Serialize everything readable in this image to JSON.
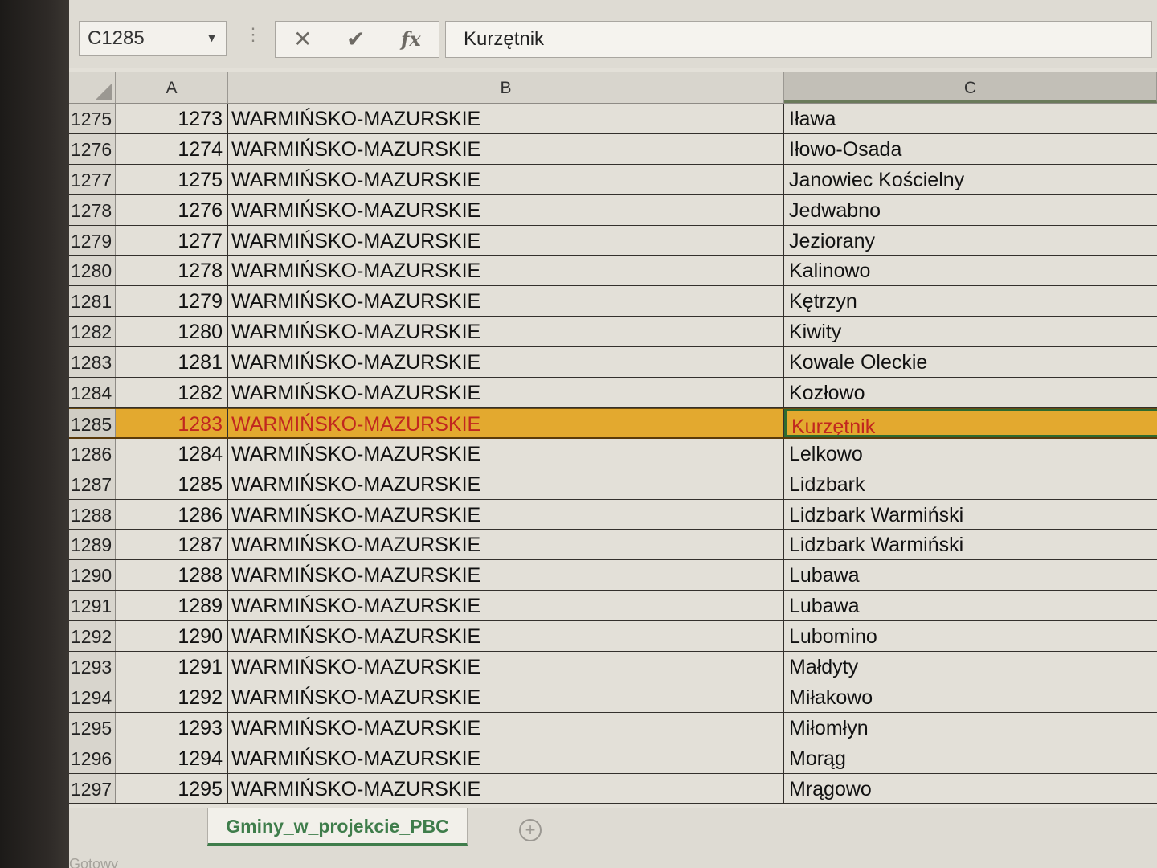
{
  "formula_bar": {
    "name_box": "C1285",
    "name_box_dropdown_icon": "chevron-down-icon",
    "options_icon": "vertical-dots-icon",
    "cancel_icon": "close-icon",
    "enter_icon": "checkmark-icon",
    "function_label": "fx",
    "content": "Kurzętnik"
  },
  "columns": [
    {
      "key": "A",
      "label": "A"
    },
    {
      "key": "B",
      "label": "B"
    },
    {
      "key": "C",
      "label": "C"
    }
  ],
  "rows": [
    {
      "row": "1275",
      "a": "1273",
      "b": "WARMIŃSKO-MAZURSKIE",
      "c": "Iława"
    },
    {
      "row": "1276",
      "a": "1274",
      "b": "WARMIŃSKO-MAZURSKIE",
      "c": "Iłowo-Osada"
    },
    {
      "row": "1277",
      "a": "1275",
      "b": "WARMIŃSKO-MAZURSKIE",
      "c": "Janowiec Kościelny"
    },
    {
      "row": "1278",
      "a": "1276",
      "b": "WARMIŃSKO-MAZURSKIE",
      "c": "Jedwabno"
    },
    {
      "row": "1279",
      "a": "1277",
      "b": "WARMIŃSKO-MAZURSKIE",
      "c": "Jeziorany"
    },
    {
      "row": "1280",
      "a": "1278",
      "b": "WARMIŃSKO-MAZURSKIE",
      "c": "Kalinowo"
    },
    {
      "row": "1281",
      "a": "1279",
      "b": "WARMIŃSKO-MAZURSKIE",
      "c": "Kętrzyn"
    },
    {
      "row": "1282",
      "a": "1280",
      "b": "WARMIŃSKO-MAZURSKIE",
      "c": "Kiwity"
    },
    {
      "row": "1283",
      "a": "1281",
      "b": "WARMIŃSKO-MAZURSKIE",
      "c": "Kowale Oleckie"
    },
    {
      "row": "1284",
      "a": "1282",
      "b": "WARMIŃSKO-MAZURSKIE",
      "c": "Kozłowo"
    },
    {
      "row": "1285",
      "a": "1283",
      "b": "WARMIŃSKO-MAZURSKIE",
      "c": "Kurzętnik",
      "highlighted": true
    },
    {
      "row": "1286",
      "a": "1284",
      "b": "WARMIŃSKO-MAZURSKIE",
      "c": "Lelkowo"
    },
    {
      "row": "1287",
      "a": "1285",
      "b": "WARMIŃSKO-MAZURSKIE",
      "c": "Lidzbark"
    },
    {
      "row": "1288",
      "a": "1286",
      "b": "WARMIŃSKO-MAZURSKIE",
      "c": "Lidzbark Warmiński"
    },
    {
      "row": "1289",
      "a": "1287",
      "b": "WARMIŃSKO-MAZURSKIE",
      "c": "Lidzbark Warmiński"
    },
    {
      "row": "1290",
      "a": "1288",
      "b": "WARMIŃSKO-MAZURSKIE",
      "c": "Lubawa"
    },
    {
      "row": "1291",
      "a": "1289",
      "b": "WARMIŃSKO-MAZURSKIE",
      "c": "Lubawa"
    },
    {
      "row": "1292",
      "a": "1290",
      "b": "WARMIŃSKO-MAZURSKIE",
      "c": "Lubomino"
    },
    {
      "row": "1293",
      "a": "1291",
      "b": "WARMIŃSKO-MAZURSKIE",
      "c": "Małdyty"
    },
    {
      "row": "1294",
      "a": "1292",
      "b": "WARMIŃSKO-MAZURSKIE",
      "c": "Miłakowo"
    },
    {
      "row": "1295",
      "a": "1293",
      "b": "WARMIŃSKO-MAZURSKIE",
      "c": "Miłomłyn"
    },
    {
      "row": "1296",
      "a": "1294",
      "b": "WARMIŃSKO-MAZURSKIE",
      "c": "Morąg"
    },
    {
      "row": "1297",
      "a": "1295",
      "b": "WARMIŃSKO-MAZURSKIE",
      "c": "Mrągowo"
    }
  ],
  "sheet_tabs": [
    {
      "label": "Gminy_w_projekcie_PBC",
      "active": true
    }
  ],
  "add_sheet_icon": "plus-circle-icon",
  "status": "Gotowy",
  "colors": {
    "highlight_fill": "#e3a92f",
    "highlight_text": "#c1271f",
    "active_tab": "#3f7d4b"
  }
}
